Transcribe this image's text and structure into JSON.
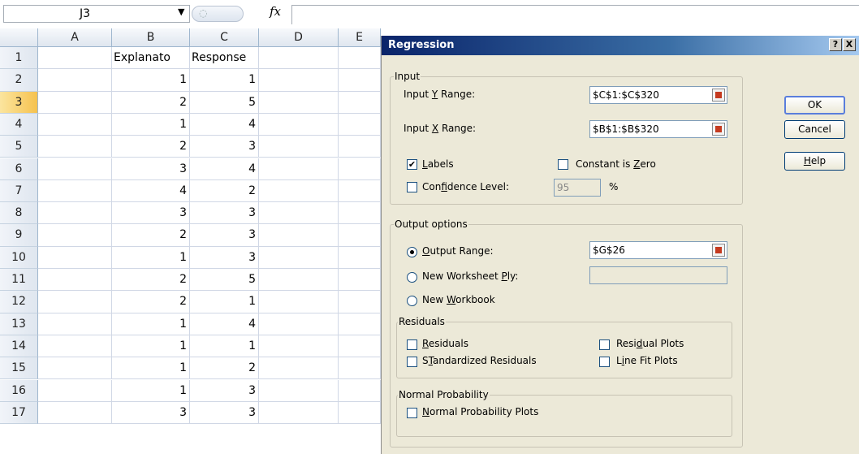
{
  "formula_bar": {
    "name_box": "J3",
    "fx_label": "fx",
    "formula": ""
  },
  "columns": [
    "A",
    "B",
    "C",
    "D",
    "E"
  ],
  "rows": [
    {
      "n": "1",
      "B": "Explanato",
      "C": "Response"
    },
    {
      "n": "2",
      "B": "1",
      "C": "1"
    },
    {
      "n": "3",
      "B": "2",
      "C": "5"
    },
    {
      "n": "4",
      "B": "1",
      "C": "4"
    },
    {
      "n": "5",
      "B": "2",
      "C": "3"
    },
    {
      "n": "6",
      "B": "3",
      "C": "4"
    },
    {
      "n": "7",
      "B": "4",
      "C": "2"
    },
    {
      "n": "8",
      "B": "3",
      "C": "3"
    },
    {
      "n": "9",
      "B": "2",
      "C": "3"
    },
    {
      "n": "10",
      "B": "1",
      "C": "3"
    },
    {
      "n": "11",
      "B": "2",
      "C": "5"
    },
    {
      "n": "12",
      "B": "2",
      "C": "1"
    },
    {
      "n": "13",
      "B": "1",
      "C": "4"
    },
    {
      "n": "14",
      "B": "1",
      "C": "1"
    },
    {
      "n": "15",
      "B": "1",
      "C": "2"
    },
    {
      "n": "16",
      "B": "1",
      "C": "3"
    },
    {
      "n": "17",
      "B": "3",
      "C": "3"
    }
  ],
  "selected_row": "3",
  "dialog": {
    "title": "Regression",
    "help_btn": "?",
    "close_btn": "X",
    "input_group": "Input",
    "y_range": {
      "label_pre": "Input ",
      "label_u": "Y",
      "label_post": " Range:",
      "value": "$C$1:$C$320"
    },
    "x_range": {
      "label_pre": "Input ",
      "label_u": "X",
      "label_post": " Range:",
      "value": "$B$1:$B$320"
    },
    "labels": {
      "u": "L",
      "rest": "abels",
      "checked": true
    },
    "const_zero": {
      "pre": "Constant is ",
      "u": "Z",
      "post": "ero",
      "checked": false
    },
    "confidence": {
      "pre": "Con",
      "u": "f",
      "post": "idence Level:",
      "checked": false,
      "value": "95",
      "unit": "%"
    },
    "output_group": "Output options",
    "output_range": {
      "pre": "",
      "u": "O",
      "post": "utput Range:",
      "value": "$G$26",
      "selected": true
    },
    "new_sheet": {
      "pre": "New Worksheet ",
      "u": "P",
      "post": "ly:",
      "value": "",
      "selected": false
    },
    "new_book": {
      "pre": "New ",
      "u": "W",
      "post": "orkbook",
      "selected": false
    },
    "residuals_group": "Residuals",
    "residuals": {
      "u": "R",
      "rest": "esiduals"
    },
    "std_residuals": {
      "u": "T",
      "pre": "S",
      "post": "andardized Residuals"
    },
    "residual_plots": {
      "pre": "Resi",
      "u": "d",
      "post": "ual Plots"
    },
    "line_fit": {
      "pre": "L",
      "u": "i",
      "post": "ne Fit Plots"
    },
    "normal_group": "Normal Probability",
    "normal_plots": {
      "u": "N",
      "rest": "ormal Probability Plots"
    },
    "ok": "OK",
    "cancel": "Cancel",
    "help": {
      "u": "H",
      "rest": "elp"
    }
  }
}
